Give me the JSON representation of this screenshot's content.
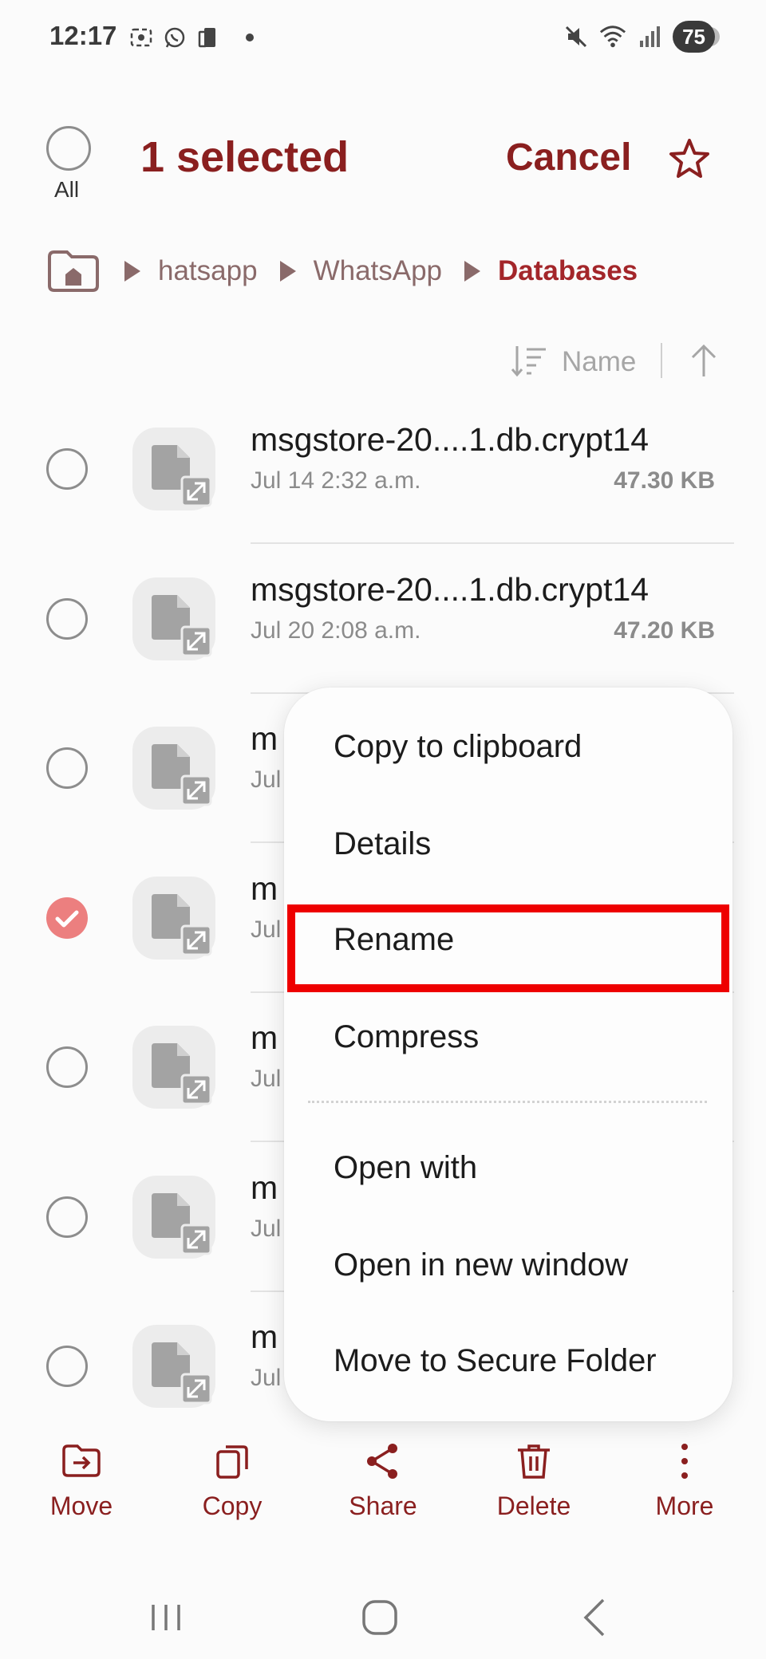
{
  "status_bar": {
    "time": "12:17",
    "battery": "75"
  },
  "header": {
    "select_all_label": "All",
    "title": "1 selected",
    "cancel_label": "Cancel"
  },
  "breadcrumb": {
    "items": [
      "hatsapp",
      "WhatsApp",
      "Databases"
    ]
  },
  "sort": {
    "label": "Name"
  },
  "files": [
    {
      "name": "msgstore-20....1.db.crypt14",
      "date": "Jul 14 2:32 a.m.",
      "size": "47.30 KB",
      "selected": false
    },
    {
      "name": "msgstore-20....1.db.crypt14",
      "date": "Jul 20 2:08 a.m.",
      "size": "47.20 KB",
      "selected": false
    },
    {
      "name": "m",
      "date": "Jul",
      "size": "",
      "selected": false
    },
    {
      "name": "m",
      "date": "Jul",
      "size": "",
      "selected": true
    },
    {
      "name": "m",
      "date": "Jul",
      "size": "",
      "selected": false
    },
    {
      "name": "m",
      "date": "Jul",
      "size": "",
      "selected": false
    },
    {
      "name": "m",
      "date": "Jul",
      "size": "",
      "selected": false
    }
  ],
  "context_menu": {
    "items": [
      "Copy to clipboard",
      "Details",
      "Rename",
      "Compress",
      "Open with",
      "Open in new window",
      "Move to Secure Folder"
    ],
    "highlighted": "Rename"
  },
  "actions": {
    "move": "Move",
    "copy": "Copy",
    "share": "Share",
    "delete": "Delete",
    "more": "More"
  },
  "colors": {
    "accent": "#8a1f1f",
    "highlight": "#ee0000",
    "check": "#ec7f7f"
  }
}
